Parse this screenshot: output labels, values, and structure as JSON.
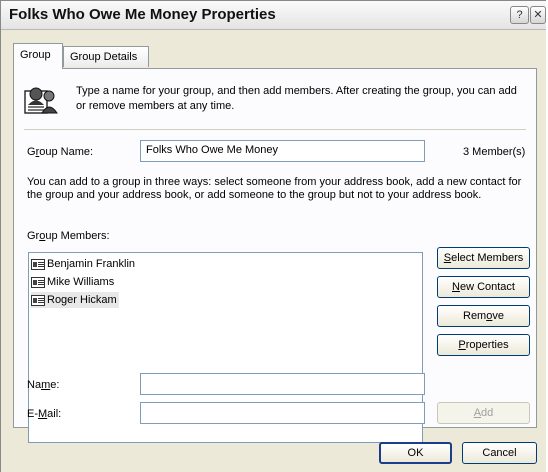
{
  "window": {
    "title": "Folks Who Owe Me Money Properties",
    "help_button": "?",
    "close_button": "✕"
  },
  "tabs": [
    {
      "label": "Group",
      "active": true
    },
    {
      "label": "Group Details",
      "active": false
    }
  ],
  "header": {
    "icon": "group-people-icon",
    "text": "Type a name for your group, and then add members. After creating the group, you can add or remove members at any time."
  },
  "group_name": {
    "label_pre": "G",
    "label_u": "r",
    "label_post": "oup Name:",
    "value": "Folks Who Owe Me Money",
    "member_count": "3 Member(s)"
  },
  "instructions": "You can add to a group in three ways: select someone from your address book, add a new contact for the group and your address book, or add someone to the group but not to your address book.",
  "members": {
    "label_pre": "Gr",
    "label_u": "o",
    "label_post": "up Members:",
    "items": [
      {
        "name": "Benjamin Franklin",
        "selected": false
      },
      {
        "name": "Mike Williams",
        "selected": false
      },
      {
        "name": "Roger Hickam",
        "selected": true
      }
    ]
  },
  "buttons": {
    "select_members": {
      "pre": "",
      "u": "S",
      "post": "elect Members"
    },
    "new_contact": {
      "pre": "",
      "u": "N",
      "post": "ew Contact"
    },
    "remove": {
      "pre": "Rem",
      "u": "o",
      "post": "ve"
    },
    "properties": {
      "pre": "",
      "u": "P",
      "post": "roperties"
    },
    "add": {
      "pre": "",
      "u": "A",
      "post": "dd"
    },
    "ok": "OK",
    "cancel": "Cancel"
  },
  "fields": {
    "name": {
      "pre": "Na",
      "u": "m",
      "post": "e:",
      "value": ""
    },
    "email": {
      "pre": "E-",
      "u": "M",
      "post": "ail:",
      "value": ""
    }
  }
}
